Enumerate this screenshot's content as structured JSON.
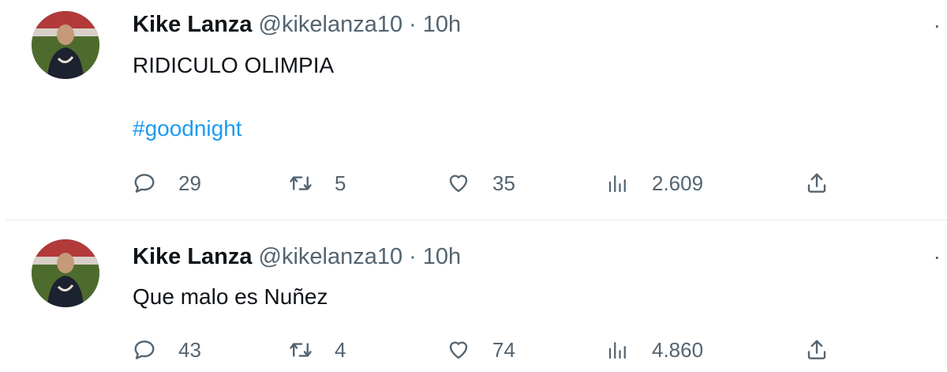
{
  "tweets": [
    {
      "name": "Kike Lanza",
      "handle": "@kikelanza10",
      "separator": "·",
      "time": "10h",
      "text": "RIDICULO OLIMPIA",
      "hashtag": "#goodnight",
      "replies": "29",
      "retweets": "5",
      "likes": "35",
      "views": "2.609",
      "more": "·"
    },
    {
      "name": "Kike Lanza",
      "handle": "@kikelanza10",
      "separator": "·",
      "time": "10h",
      "text": "Que malo es Nuñez",
      "replies": "43",
      "retweets": "4",
      "likes": "74",
      "views": "4.860",
      "more": "·"
    }
  ],
  "colors": {
    "hashtag": "#1d9bf0",
    "secondary_text": "#536471",
    "divider": "#e7e9ea"
  },
  "icons": [
    "reply-icon",
    "retweet-icon",
    "like-icon",
    "views-icon",
    "share-icon",
    "more-icon"
  ]
}
